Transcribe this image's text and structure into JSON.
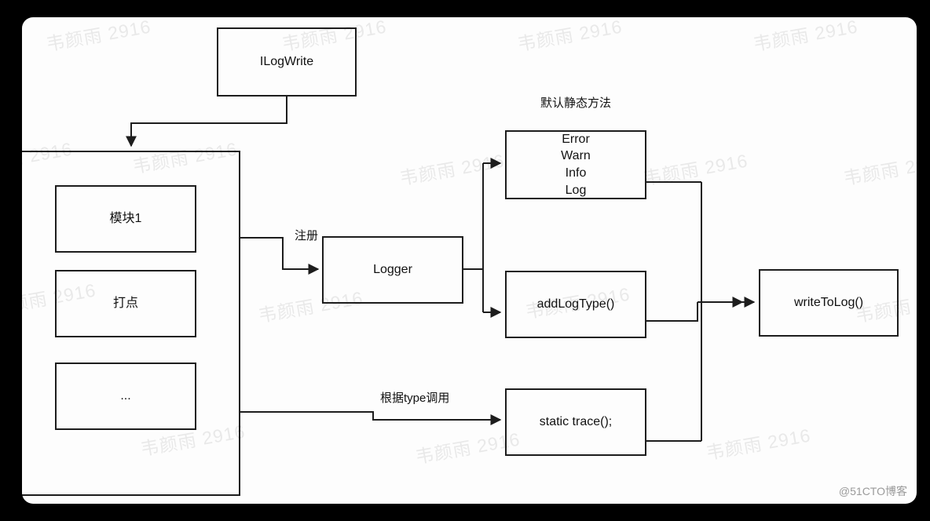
{
  "diagram": {
    "background_color": "#000000",
    "card_color": "#fdfdfd",
    "stroke_color": "#1d1d1d",
    "text_color": "#111111",
    "watermark": {
      "text": "韦颜雨 2916",
      "color": "#e9e9e9"
    },
    "credit": "@51CTO博客",
    "labels": {
      "default_static_methods": "默认静态方法",
      "register": "注册",
      "call_by_type": "根据type调用"
    },
    "nodes": {
      "ilogwrite": "ILogWrite",
      "module1": "模块1",
      "tracking": "打点",
      "ellipsis": "...",
      "logger": "Logger",
      "log_levels": [
        "Error",
        "Warn",
        "Info",
        "Log"
      ],
      "add_log_type": "addLogType()",
      "static_trace": "static trace();",
      "write_to_log": "writeToLog()"
    }
  }
}
